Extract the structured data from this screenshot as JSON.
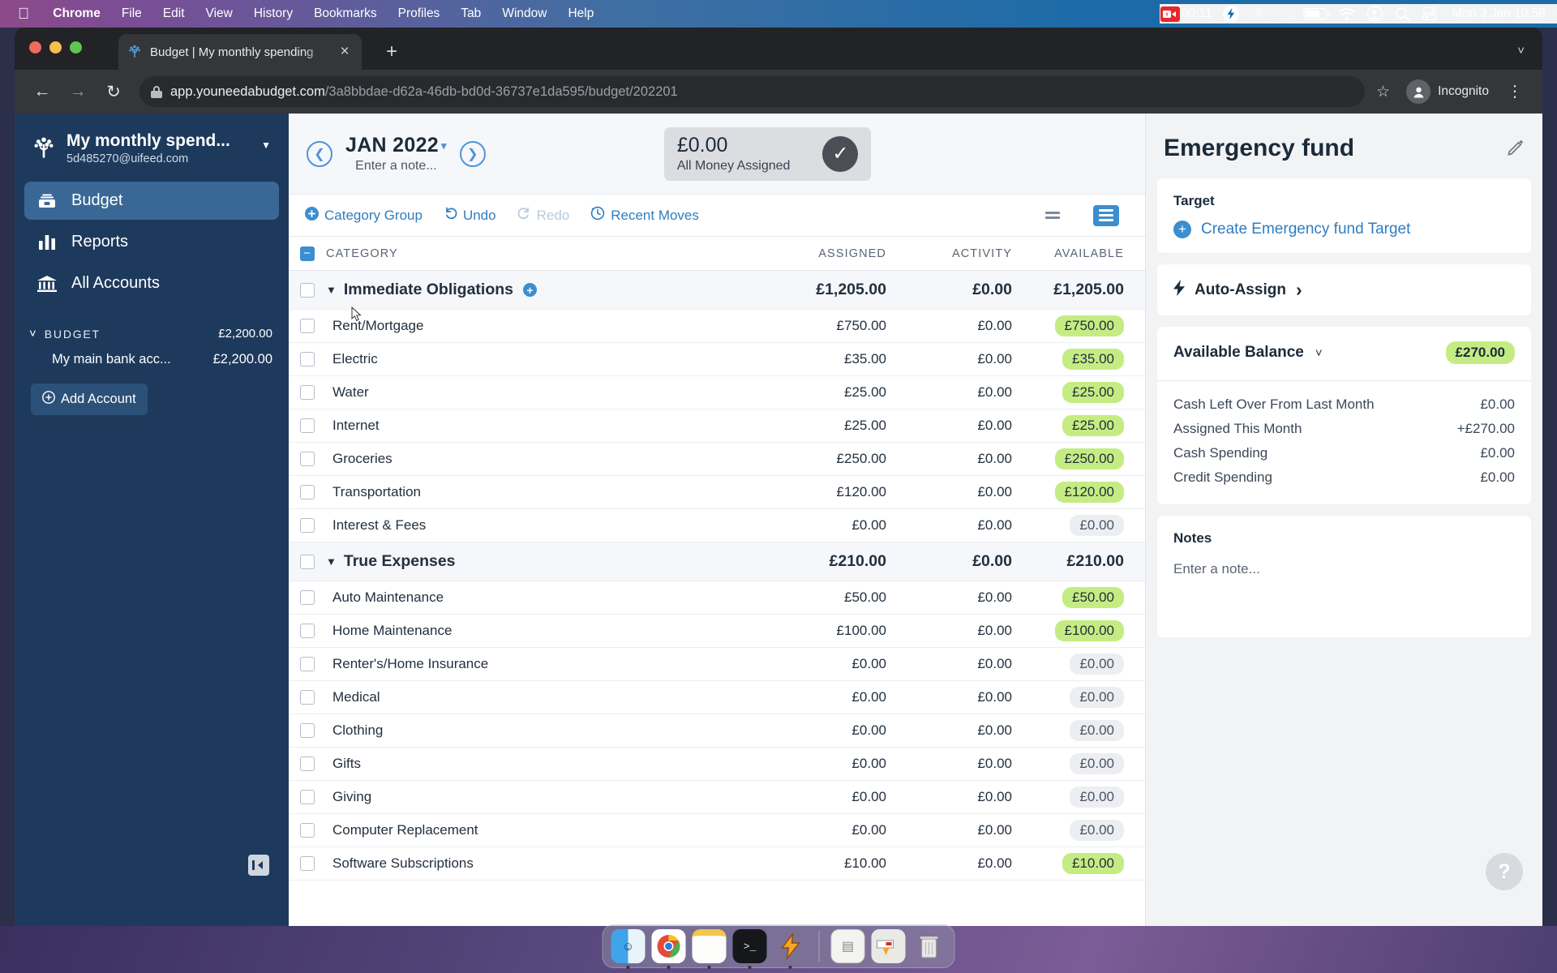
{
  "menubar": {
    "apple_icon": "apple-icon",
    "items": [
      "Chrome",
      "File",
      "Edit",
      "View",
      "History",
      "Bookmarks",
      "Profiles",
      "Tab",
      "Window",
      "Help"
    ],
    "recording_time": "00:11",
    "status_icons": [
      "screen-record-icon",
      "lightning-icon",
      "bluetooth-off-icon",
      "keyboard-brightness-icon",
      "battery-icon",
      "wifi-icon",
      "account-icon",
      "search-icon",
      "control-center-icon"
    ],
    "clock": "Mon 3 Jan  10:59"
  },
  "browser": {
    "tab_title": "Budget | My monthly spending",
    "tab_favicon": "ynab-tree-icon",
    "close_label": "×",
    "newtab_label": "+",
    "tabs_chevron": "˅",
    "back_label": "←",
    "forward_label": "→",
    "reload_label": "↻",
    "url_host": "app.youneedabudget.com",
    "url_path": "/3a8bbdae-d62a-46db-bd0d-36737e1da595/budget/202201",
    "star_label": "☆",
    "incognito_label": "Incognito",
    "kebab_label": "⋮"
  },
  "sidebar": {
    "budget_name": "My monthly spend...",
    "email": "5d485270@uifeed.com",
    "caret": "▼",
    "nav": [
      {
        "label": "Budget",
        "icon": "budget-icon",
        "active": true
      },
      {
        "label": "Reports",
        "icon": "reports-bars-icon",
        "active": false
      },
      {
        "label": "All Accounts",
        "icon": "bank-icon",
        "active": false
      }
    ],
    "section_label": "BUDGET",
    "section_chevron": "˅",
    "section_total": "£2,200.00",
    "accounts": [
      {
        "name": "My main bank acc...",
        "balance": "£2,200.00"
      }
    ],
    "add_account_label": "Add Account",
    "add_account_icon": "plus-circle-icon",
    "collapse_icon": "collapse-sidebar-icon"
  },
  "header": {
    "prev_icon": "chevron-left-circle-icon",
    "next_icon": "chevron-right-circle-icon",
    "month": "JAN 2022",
    "month_caret": "▾",
    "note_placeholder": "Enter a note...",
    "assigned_amount": "£0.00",
    "assigned_label": "All Money Assigned",
    "check_icon": "check-circle-icon"
  },
  "toolbar": {
    "category_group_label": "Category Group",
    "category_group_icon": "plus-circle-icon",
    "undo_label": "Undo",
    "undo_icon": "undo-arrow-icon",
    "redo_label": "Redo",
    "redo_icon": "redo-arrow-icon",
    "recent_moves_label": "Recent Moves",
    "recent_moves_icon": "history-clock-icon",
    "view_compact_icon": "view-compact-icon",
    "view_expanded_icon": "view-expanded-icon"
  },
  "table": {
    "headers": [
      "CATEGORY",
      "ASSIGNED",
      "ACTIVITY",
      "AVAILABLE"
    ],
    "select_all_state": "indeterminate",
    "rows": [
      {
        "type": "group",
        "name": "Immediate Obligations",
        "assigned": "£1,205.00",
        "activity": "£0.00",
        "available": "£1,205.00",
        "pill": "none"
      },
      {
        "type": "sub",
        "name": "Rent/Mortgage",
        "assigned": "£750.00",
        "activity": "£0.00",
        "available": "£750.00",
        "pill": "green"
      },
      {
        "type": "sub",
        "name": "Electric",
        "assigned": "£35.00",
        "activity": "£0.00",
        "available": "£35.00",
        "pill": "green"
      },
      {
        "type": "sub",
        "name": "Water",
        "assigned": "£25.00",
        "activity": "£0.00",
        "available": "£25.00",
        "pill": "green"
      },
      {
        "type": "sub",
        "name": "Internet",
        "assigned": "£25.00",
        "activity": "£0.00",
        "available": "£25.00",
        "pill": "green"
      },
      {
        "type": "sub",
        "name": "Groceries",
        "assigned": "£250.00",
        "activity": "£0.00",
        "available": "£250.00",
        "pill": "green"
      },
      {
        "type": "sub",
        "name": "Transportation",
        "assigned": "£120.00",
        "activity": "£0.00",
        "available": "£120.00",
        "pill": "green"
      },
      {
        "type": "sub",
        "name": "Interest & Fees",
        "assigned": "£0.00",
        "activity": "£0.00",
        "available": "£0.00",
        "pill": "grey"
      },
      {
        "type": "group",
        "name": "True Expenses",
        "assigned": "£210.00",
        "activity": "£0.00",
        "available": "£210.00",
        "pill": "none"
      },
      {
        "type": "sub",
        "name": "Auto Maintenance",
        "assigned": "£50.00",
        "activity": "£0.00",
        "available": "£50.00",
        "pill": "green"
      },
      {
        "type": "sub",
        "name": "Home Maintenance",
        "assigned": "£100.00",
        "activity": "£0.00",
        "available": "£100.00",
        "pill": "green"
      },
      {
        "type": "sub",
        "name": "Renter's/Home Insurance",
        "assigned": "£0.00",
        "activity": "£0.00",
        "available": "£0.00",
        "pill": "grey"
      },
      {
        "type": "sub",
        "name": "Medical",
        "assigned": "£0.00",
        "activity": "£0.00",
        "available": "£0.00",
        "pill": "grey"
      },
      {
        "type": "sub",
        "name": "Clothing",
        "assigned": "£0.00",
        "activity": "£0.00",
        "available": "£0.00",
        "pill": "grey"
      },
      {
        "type": "sub",
        "name": "Gifts",
        "assigned": "£0.00",
        "activity": "£0.00",
        "available": "£0.00",
        "pill": "grey"
      },
      {
        "type": "sub",
        "name": "Giving",
        "assigned": "£0.00",
        "activity": "£0.00",
        "available": "£0.00",
        "pill": "grey"
      },
      {
        "type": "sub",
        "name": "Computer Replacement",
        "assigned": "£0.00",
        "activity": "£0.00",
        "available": "£0.00",
        "pill": "grey"
      },
      {
        "type": "sub",
        "name": "Software Subscriptions",
        "assigned": "£10.00",
        "activity": "£0.00",
        "available": "£10.00",
        "pill": "green"
      }
    ]
  },
  "detail": {
    "title": "Emergency fund",
    "edit_icon": "pencil-icon",
    "target_label": "Target",
    "create_target_label": "Create Emergency fund Target",
    "create_target_icon": "plus-circle-icon",
    "auto_assign_label": "Auto-Assign",
    "auto_assign_icon": "lightning-bolt-icon",
    "auto_assign_chevron": "›",
    "available_balance_label": "Available Balance",
    "available_balance_chevron": "˅",
    "available_balance_amount": "£270.00",
    "breakdown": [
      {
        "label": "Cash Left Over From Last Month",
        "value": "£0.00"
      },
      {
        "label": "Assigned This Month",
        "value": "+£270.00"
      },
      {
        "label": "Cash Spending",
        "value": "£0.00"
      },
      {
        "label": "Credit Spending",
        "value": "£0.00"
      }
    ],
    "notes_label": "Notes",
    "notes_placeholder": "Enter a note...",
    "help_label": "?"
  },
  "dock": {
    "items": [
      "finder-icon",
      "chrome-icon",
      "notes-icon",
      "terminal-icon",
      "lightning-app-icon",
      "documents-stack-icon",
      "screenshot-icon",
      "trash-icon"
    ]
  },
  "colors": {
    "accent_blue": "#3b8ed0",
    "sidebar_navy": "#1d3a5c",
    "pill_green": "#c5ec82",
    "pill_grey": "#eceef1"
  }
}
